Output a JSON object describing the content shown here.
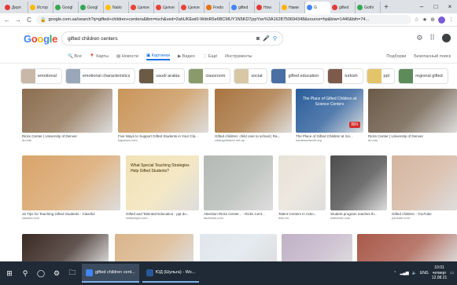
{
  "browser": {
    "tabs": [
      {
        "label": "Дерп",
        "color": "#e53935"
      },
      {
        "label": "Истор",
        "color": "#fbbc05"
      },
      {
        "label": "Googl",
        "color": "#34a853"
      },
      {
        "label": "Googl",
        "color": "#34a853"
      },
      {
        "label": "Natio",
        "color": "#ffc107"
      },
      {
        "label": "Целое",
        "color": "#ea4335"
      },
      {
        "label": "Целое",
        "color": "#ea4335"
      },
      {
        "label": "Целое",
        "color": "#ea4335"
      },
      {
        "label": "Fredo",
        "color": "#e8710a"
      },
      {
        "label": "gifted",
        "color": "#4285f4"
      },
      {
        "label": "How",
        "color": "#e53935"
      },
      {
        "label": "Нами",
        "color": "#ffb300"
      },
      {
        "label": "G",
        "color": "#4285f4",
        "active": true
      },
      {
        "label": "gifted",
        "color": "#e53935"
      },
      {
        "label": "Gothi",
        "color": "#34a853"
      }
    ],
    "new_tab": "+",
    "window_controls": [
      "–",
      "□",
      "×"
    ],
    "nav": {
      "back": "←",
      "forward": "→",
      "reload": "C"
    },
    "url": "google.com.ua/search?q=gifted+children+centers&tbm=isch&ved=2ahUKEwi0-WdnR5e6BCMUY1N5KD7jzpYwr%3A1628750694348&source=hp&biw=1440&bih=74...",
    "right_icons": [
      "☆",
      "★",
      "⊕",
      "⋮"
    ]
  },
  "google": {
    "logo_letters": [
      {
        "ch": "G",
        "color": "#4285f4"
      },
      {
        "ch": "o",
        "color": "#ea4335"
      },
      {
        "ch": "o",
        "color": "#fbbc05"
      },
      {
        "ch": "g",
        "color": "#4285f4"
      },
      {
        "ch": "l",
        "color": "#34a853"
      },
      {
        "ch": "e",
        "color": "#ea4335"
      }
    ],
    "query": "gifted children centers",
    "search_nav": [
      {
        "label": "Все",
        "icon": "🔍"
      },
      {
        "label": "Карты",
        "icon": "📍"
      },
      {
        "label": "Новости",
        "icon": "▤"
      },
      {
        "label": "Картинки",
        "icon": "▣",
        "active": true
      },
      {
        "label": "Видео",
        "icon": "▶"
      },
      {
        "label": "Ещё",
        "icon": "⋮"
      },
      {
        "label": "Инструменты",
        "icon": ""
      }
    ],
    "right_nav": [
      "Подборки",
      "Безопасный поиск"
    ]
  },
  "chips": [
    {
      "label": "emotional",
      "thumb": "#c9b8a8"
    },
    {
      "label": "emotional characteristics",
      "thumb": "#9aa7b8"
    },
    {
      "label": "saudi arabia",
      "thumb": "#6b5b45"
    },
    {
      "label": "classroom",
      "thumb": "#8a9a6b"
    },
    {
      "label": "social",
      "thumb": "#d8c7a5"
    },
    {
      "label": "gifted education",
      "thumb": "#4a6fa5"
    },
    {
      "label": "turkish",
      "thumb": "#7d5a4a"
    },
    {
      "label": "ppt",
      "thumb": "#e3c46b"
    },
    {
      "label": "regional gifted",
      "thumb": "#5e8b5a"
    }
  ],
  "results": [
    {
      "title": "Ricks Center | University of Denver",
      "source": "du.edu",
      "color": "#8c6e4f"
    },
    {
      "title": "Five Ways to Support Gifted Students in Your Cla...",
      "source": "kaplanco.com",
      "color": "#c9955a"
    },
    {
      "title": "Gifted children: child care to school | Ra...",
      "source": "raisingchildren.net.au",
      "color": "#a8743f"
    },
    {
      "title": "The Place of Gifted Children at Sci...",
      "source": "namesnetwork.org",
      "color": "#2a5d9a",
      "overlay": "The Place of Gifted Children at Science Centers",
      "badge": "ttm"
    },
    {
      "title": "Ricks Center | University of Denver",
      "source": "du.edu",
      "color": "#6b5a48"
    },
    {
      "title": "16 Tips for Teaching Gifted Students - Classful",
      "source": "classful.com",
      "color": "#d9a46a"
    },
    {
      "title": "Gifted and Talented Education - ppt do...",
      "source": "slideplayer.com",
      "color": "#f1e2b6",
      "overlay": "What Special Teaching Strategies Help Gifted Students?"
    },
    {
      "title": "Attention Ricks Center... - Ricks Cent...",
      "source": "facebook.com",
      "color": "#b4b9b5"
    },
    {
      "title": "Talent Centers in Actio...",
      "source": "etan.eu",
      "color": "#e8e2d8"
    },
    {
      "title": "Student program reaches th...",
      "source": "wsbnews.com",
      "color": "#4d4d4d"
    },
    {
      "title": "Gifted children - YouTube",
      "source": "youtube.com",
      "color": "#d4b5a0"
    },
    {
      "title": "",
      "source": "",
      "color": "#3b2a24"
    },
    {
      "title": "",
      "source": "",
      "color": "#d9b48a"
    },
    {
      "title": "",
      "source": "",
      "color": "#dfe6ec"
    },
    {
      "title": "",
      "source": "",
      "color": "#c1b2c7"
    },
    {
      "title": "",
      "source": "",
      "color": "#a85a4a"
    }
  ],
  "taskbar": {
    "apps": [
      {
        "label": "gifted children cent...",
        "color": "#4285f4"
      },
      {
        "label": "ЮД (Шульга) - Wo...",
        "color": "#2b579a"
      }
    ],
    "tray_lang": "ENG",
    "time": "10:01",
    "day": "четверг",
    "date": "12.08.21"
  }
}
